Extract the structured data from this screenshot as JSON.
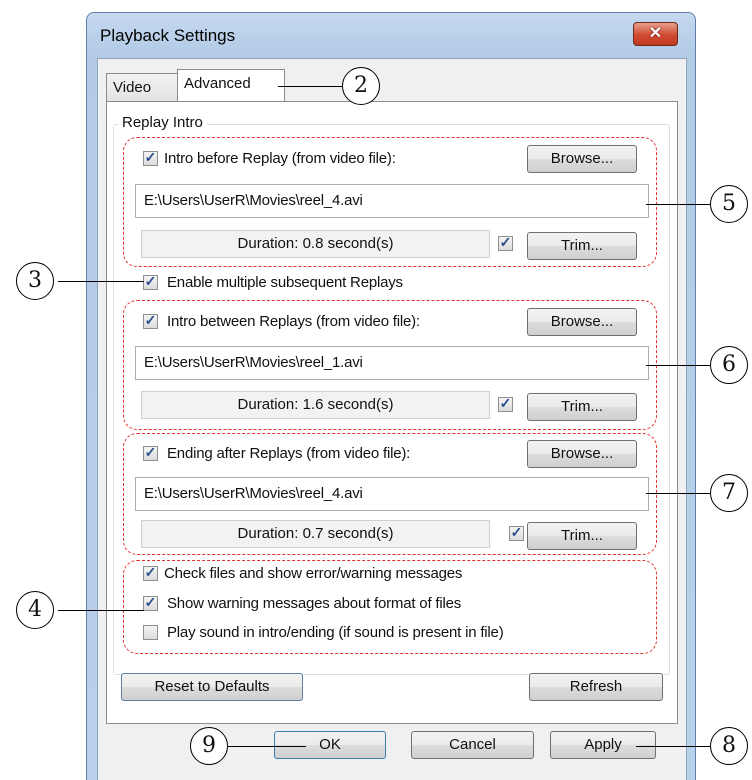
{
  "window": {
    "title": "Playback Settings",
    "close_glyph": "✕"
  },
  "tabs": [
    {
      "label": "Video"
    },
    {
      "label": "Advanced"
    }
  ],
  "group": {
    "title": "Replay Intro"
  },
  "intro": {
    "checkbox_label": "Intro before Replay (from video file):",
    "checked": true,
    "browse_label": "Browse...",
    "path": "E:\\Users\\UserR\\Movies\\reel_4.avi",
    "duration": "Duration: 0.8 second(s)",
    "trim_checked": true,
    "trim_label": "Trim..."
  },
  "enable_multiple": {
    "label": "Enable multiple subsequent Replays",
    "checked": true
  },
  "between": {
    "checkbox_label": "Intro between Replays (from video file):",
    "checked": true,
    "browse_label": "Browse...",
    "path": "E:\\Users\\UserR\\Movies\\reel_1.avi",
    "duration": "Duration: 1.6 second(s)",
    "trim_checked": true,
    "trim_label": "Trim..."
  },
  "ending": {
    "checkbox_label": "Ending after Replays (from video file):",
    "checked": true,
    "browse_label": "Browse...",
    "path": "E:\\Users\\UserR\\Movies\\reel_4.avi",
    "duration": "Duration: 0.7 second(s)",
    "trim_checked": true,
    "trim_label": "Trim..."
  },
  "options": [
    {
      "label": "Check files and show error/warning messages",
      "checked": true
    },
    {
      "label": "Show warning messages about format of files",
      "checked": true
    },
    {
      "label": "Play sound in intro/ending (if sound is present in file)",
      "checked": false
    }
  ],
  "buttons": {
    "reset_label": "Reset to Defaults",
    "refresh_label": "Refresh",
    "ok_label": "OK",
    "cancel_label": "Cancel",
    "apply_label": "Apply"
  },
  "check_glyph": "✓",
  "callouts": {
    "c2": "2",
    "c3": "3",
    "c4": "4",
    "c5": "5",
    "c6": "6",
    "c7": "7",
    "c8": "8",
    "c9": "9"
  },
  "colors": {
    "annotation_red": "#e3312f",
    "title_bar": "#b9d0ea"
  }
}
